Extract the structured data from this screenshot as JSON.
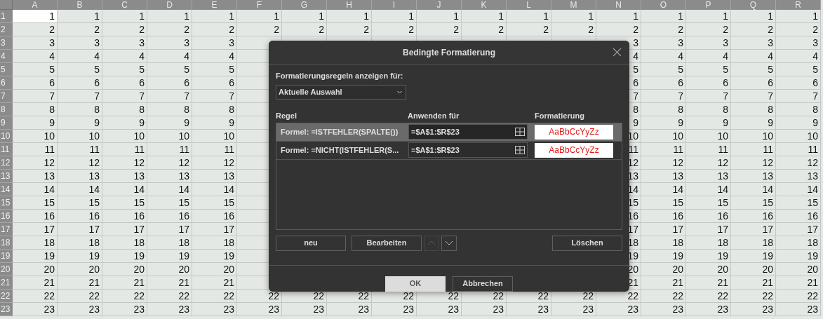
{
  "sheet": {
    "columns": [
      "A",
      "B",
      "C",
      "D",
      "E",
      "F",
      "G",
      "H",
      "I",
      "J",
      "K",
      "L",
      "M",
      "N",
      "O",
      "P",
      "Q",
      "R"
    ],
    "rows": [
      {
        "header": "1",
        "cells": [
          {
            "text": "1",
            "selected": true
          },
          {
            "text": "1",
            "selected": false
          },
          {
            "text": "1",
            "selected": false
          },
          {
            "text": "1",
            "selected": false
          },
          {
            "text": "1",
            "selected": false
          },
          {
            "text": "1",
            "selected": false
          },
          {
            "text": "1",
            "selected": false
          },
          {
            "text": "1",
            "selected": false
          },
          {
            "text": "1",
            "selected": false
          },
          {
            "text": "1",
            "selected": false
          },
          {
            "text": "1",
            "selected": false
          },
          {
            "text": "1",
            "selected": false
          },
          {
            "text": "1",
            "selected": false
          },
          {
            "text": "1",
            "selected": false
          },
          {
            "text": "1",
            "selected": false
          },
          {
            "text": "1",
            "selected": false
          },
          {
            "text": "1",
            "selected": false
          },
          {
            "text": "1",
            "selected": false
          }
        ]
      },
      {
        "header": "2",
        "cells": [
          {
            "text": "2",
            "selected": false
          },
          {
            "text": "2",
            "selected": false
          },
          {
            "text": "2",
            "selected": false
          },
          {
            "text": "2",
            "selected": false
          },
          {
            "text": "2",
            "selected": false
          },
          {
            "text": "2",
            "selected": false
          },
          {
            "text": "2",
            "selected": false
          },
          {
            "text": "2",
            "selected": false
          },
          {
            "text": "2",
            "selected": false
          },
          {
            "text": "2",
            "selected": false
          },
          {
            "text": "2",
            "selected": false
          },
          {
            "text": "2",
            "selected": false
          },
          {
            "text": "2",
            "selected": false
          },
          {
            "text": "2",
            "selected": false
          },
          {
            "text": "2",
            "selected": false
          },
          {
            "text": "2",
            "selected": false
          },
          {
            "text": "2",
            "selected": false
          },
          {
            "text": "2",
            "selected": false
          }
        ]
      },
      {
        "header": "3",
        "cells_left": [
          {
            "text": "3",
            "selected": false
          },
          {
            "text": "3",
            "selected": false
          },
          {
            "text": "3",
            "selected": false
          },
          {
            "text": "3",
            "selected": false
          },
          {
            "text": "3",
            "selected": false
          }
        ],
        "cells_right": [
          {
            "text": "3",
            "selected": false
          },
          {
            "text": "3",
            "selected": false
          },
          {
            "text": "3",
            "selected": false
          },
          {
            "text": "3",
            "selected": false
          },
          {
            "text": "3",
            "selected": false
          }
        ]
      },
      {
        "header": "4",
        "cells_left": [
          {
            "text": "4",
            "selected": false
          },
          {
            "text": "4",
            "selected": false
          },
          {
            "text": "4",
            "selected": false
          },
          {
            "text": "4",
            "selected": false
          },
          {
            "text": "4",
            "selected": false
          }
        ],
        "cells_right": [
          {
            "text": "4",
            "selected": false
          },
          {
            "text": "4",
            "selected": false
          },
          {
            "text": "4",
            "selected": false
          },
          {
            "text": "4",
            "selected": false
          },
          {
            "text": "4",
            "selected": false
          }
        ]
      },
      {
        "header": "5",
        "cells_left": [
          {
            "text": "5",
            "selected": false
          },
          {
            "text": "5",
            "selected": false
          },
          {
            "text": "5",
            "selected": false
          },
          {
            "text": "5",
            "selected": false
          },
          {
            "text": "5",
            "selected": false
          }
        ],
        "cells_right": [
          {
            "text": "5",
            "selected": false
          },
          {
            "text": "5",
            "selected": false
          },
          {
            "text": "5",
            "selected": false
          },
          {
            "text": "5",
            "selected": false
          },
          {
            "text": "5",
            "selected": false
          }
        ]
      },
      {
        "header": "6",
        "cells_left": [
          {
            "text": "6",
            "selected": false
          },
          {
            "text": "6",
            "selected": false
          },
          {
            "text": "6",
            "selected": false
          },
          {
            "text": "6",
            "selected": false
          },
          {
            "text": "6",
            "selected": false
          }
        ],
        "cells_right": [
          {
            "text": "6",
            "selected": false
          },
          {
            "text": "6",
            "selected": false
          },
          {
            "text": "6",
            "selected": false
          },
          {
            "text": "6",
            "selected": false
          },
          {
            "text": "6",
            "selected": false
          }
        ]
      },
      {
        "header": "7",
        "cells_left": [
          {
            "text": "7",
            "selected": false
          },
          {
            "text": "7",
            "selected": false
          },
          {
            "text": "7",
            "selected": false
          },
          {
            "text": "7",
            "selected": false
          },
          {
            "text": "7",
            "selected": false
          }
        ],
        "cells_right": [
          {
            "text": "7",
            "selected": false
          },
          {
            "text": "7",
            "selected": false
          },
          {
            "text": "7",
            "selected": false
          },
          {
            "text": "7",
            "selected": false
          },
          {
            "text": "7",
            "selected": false
          }
        ]
      },
      {
        "header": "8",
        "cells_left": [
          {
            "text": "8",
            "selected": false
          },
          {
            "text": "8",
            "selected": false
          },
          {
            "text": "8",
            "selected": false
          },
          {
            "text": "8",
            "selected": false
          },
          {
            "text": "8",
            "selected": false
          }
        ],
        "cells_right": [
          {
            "text": "8",
            "selected": false
          },
          {
            "text": "8",
            "selected": false
          },
          {
            "text": "8",
            "selected": false
          },
          {
            "text": "8",
            "selected": false
          },
          {
            "text": "8",
            "selected": false
          }
        ]
      },
      {
        "header": "9",
        "cells_left": [
          {
            "text": "9",
            "selected": false
          },
          {
            "text": "9",
            "selected": false
          },
          {
            "text": "9",
            "selected": false
          },
          {
            "text": "9",
            "selected": false
          },
          {
            "text": "9",
            "selected": false
          }
        ],
        "cells_right": [
          {
            "text": "9",
            "selected": false
          },
          {
            "text": "9",
            "selected": false
          },
          {
            "text": "9",
            "selected": false
          },
          {
            "text": "9",
            "selected": false
          },
          {
            "text": "9",
            "selected": false
          }
        ]
      },
      {
        "header": "10",
        "cells_left": [
          {
            "text": "10",
            "selected": false
          },
          {
            "text": "10",
            "selected": false
          },
          {
            "text": "10",
            "selected": false
          },
          {
            "text": "10",
            "selected": false
          },
          {
            "text": "10",
            "selected": false
          }
        ],
        "cells_right": [
          {
            "text": "10",
            "selected": false
          },
          {
            "text": "10",
            "selected": false
          },
          {
            "text": "10",
            "selected": false
          },
          {
            "text": "10",
            "selected": false
          },
          {
            "text": "10",
            "selected": false
          }
        ]
      },
      {
        "header": "11",
        "cells_left": [
          {
            "text": "11",
            "selected": false
          },
          {
            "text": "11",
            "selected": false
          },
          {
            "text": "11",
            "selected": false
          },
          {
            "text": "11",
            "selected": false
          },
          {
            "text": "11",
            "selected": false
          }
        ],
        "cells_right": [
          {
            "text": "11",
            "selected": false
          },
          {
            "text": "11",
            "selected": false
          },
          {
            "text": "11",
            "selected": false
          },
          {
            "text": "11",
            "selected": false
          },
          {
            "text": "11",
            "selected": false
          }
        ]
      },
      {
        "header": "12",
        "cells_left": [
          {
            "text": "12",
            "selected": false
          },
          {
            "text": "12",
            "selected": false
          },
          {
            "text": "12",
            "selected": false
          },
          {
            "text": "12",
            "selected": false
          },
          {
            "text": "12",
            "selected": false
          }
        ],
        "cells_right": [
          {
            "text": "12",
            "selected": false
          },
          {
            "text": "12",
            "selected": false
          },
          {
            "text": "12",
            "selected": false
          },
          {
            "text": "12",
            "selected": false
          },
          {
            "text": "12",
            "selected": false
          }
        ]
      },
      {
        "header": "13",
        "cells_left": [
          {
            "text": "13",
            "selected": false
          },
          {
            "text": "13",
            "selected": false
          },
          {
            "text": "13",
            "selected": false
          },
          {
            "text": "13",
            "selected": false
          },
          {
            "text": "13",
            "selected": false
          }
        ],
        "cells_right": [
          {
            "text": "13",
            "selected": false
          },
          {
            "text": "13",
            "selected": false
          },
          {
            "text": "13",
            "selected": false
          },
          {
            "text": "13",
            "selected": false
          },
          {
            "text": "13",
            "selected": false
          }
        ]
      },
      {
        "header": "14",
        "cells_left": [
          {
            "text": "14",
            "selected": false
          },
          {
            "text": "14",
            "selected": false
          },
          {
            "text": "14",
            "selected": false
          },
          {
            "text": "14",
            "selected": false
          },
          {
            "text": "14",
            "selected": false
          }
        ],
        "cells_right": [
          {
            "text": "14",
            "selected": false
          },
          {
            "text": "14",
            "selected": false
          },
          {
            "text": "14",
            "selected": false
          },
          {
            "text": "14",
            "selected": false
          },
          {
            "text": "14",
            "selected": false
          }
        ]
      },
      {
        "header": "15",
        "cells_left": [
          {
            "text": "15",
            "selected": false
          },
          {
            "text": "15",
            "selected": false
          },
          {
            "text": "15",
            "selected": false
          },
          {
            "text": "15",
            "selected": false
          },
          {
            "text": "15",
            "selected": false
          }
        ],
        "cells_right": [
          {
            "text": "15",
            "selected": false
          },
          {
            "text": "15",
            "selected": false
          },
          {
            "text": "15",
            "selected": false
          },
          {
            "text": "15",
            "selected": false
          },
          {
            "text": "15",
            "selected": false
          }
        ]
      },
      {
        "header": "16",
        "cells_left": [
          {
            "text": "16",
            "selected": false
          },
          {
            "text": "16",
            "selected": false
          },
          {
            "text": "16",
            "selected": false
          },
          {
            "text": "16",
            "selected": false
          },
          {
            "text": "16",
            "selected": false
          }
        ],
        "cells_right": [
          {
            "text": "16",
            "selected": false
          },
          {
            "text": "16",
            "selected": false
          },
          {
            "text": "16",
            "selected": false
          },
          {
            "text": "16",
            "selected": false
          },
          {
            "text": "16",
            "selected": false
          }
        ]
      },
      {
        "header": "17",
        "cells_left": [
          {
            "text": "17",
            "selected": false
          },
          {
            "text": "17",
            "selected": false
          },
          {
            "text": "17",
            "selected": false
          },
          {
            "text": "17",
            "selected": false
          },
          {
            "text": "17",
            "selected": false
          }
        ],
        "cells_right": [
          {
            "text": "17",
            "selected": false
          },
          {
            "text": "17",
            "selected": false
          },
          {
            "text": "17",
            "selected": false
          },
          {
            "text": "17",
            "selected": false
          },
          {
            "text": "17",
            "selected": false
          }
        ]
      },
      {
        "header": "18",
        "cells_left": [
          {
            "text": "18",
            "selected": false
          },
          {
            "text": "18",
            "selected": false
          },
          {
            "text": "18",
            "selected": false
          },
          {
            "text": "18",
            "selected": false
          },
          {
            "text": "18",
            "selected": false
          }
        ],
        "cells_right": [
          {
            "text": "18",
            "selected": false
          },
          {
            "text": "18",
            "selected": false
          },
          {
            "text": "18",
            "selected": false
          },
          {
            "text": "18",
            "selected": false
          },
          {
            "text": "18",
            "selected": false
          }
        ]
      },
      {
        "header": "19",
        "cells_left": [
          {
            "text": "19",
            "selected": false
          },
          {
            "text": "19",
            "selected": false
          },
          {
            "text": "19",
            "selected": false
          },
          {
            "text": "19",
            "selected": false
          },
          {
            "text": "19",
            "selected": false
          }
        ],
        "cells_right": [
          {
            "text": "19",
            "selected": false
          },
          {
            "text": "19",
            "selected": false
          },
          {
            "text": "19",
            "selected": false
          },
          {
            "text": "19",
            "selected": false
          },
          {
            "text": "19",
            "selected": false
          }
        ]
      },
      {
        "header": "20",
        "cells_left": [
          {
            "text": "20",
            "selected": false
          },
          {
            "text": "20",
            "selected": false
          },
          {
            "text": "20",
            "selected": false
          },
          {
            "text": "20",
            "selected": false
          },
          {
            "text": "20",
            "selected": false
          }
        ],
        "cells_right": [
          {
            "text": "20",
            "selected": false
          },
          {
            "text": "20",
            "selected": false
          },
          {
            "text": "20",
            "selected": false
          },
          {
            "text": "20",
            "selected": false
          },
          {
            "text": "20",
            "selected": false
          }
        ]
      },
      {
        "header": "21",
        "cells_left": [
          {
            "text": "21",
            "selected": false
          },
          {
            "text": "21",
            "selected": false
          },
          {
            "text": "21",
            "selected": false
          },
          {
            "text": "21",
            "selected": false
          },
          {
            "text": "21",
            "selected": false
          }
        ],
        "cells_right": [
          {
            "text": "21",
            "selected": false
          },
          {
            "text": "21",
            "selected": false
          },
          {
            "text": "21",
            "selected": false
          },
          {
            "text": "21",
            "selected": false
          },
          {
            "text": "21",
            "selected": false
          }
        ]
      },
      {
        "header": "22",
        "cells": [
          {
            "text": "22",
            "selected": false
          },
          {
            "text": "22",
            "selected": false
          },
          {
            "text": "22",
            "selected": false
          },
          {
            "text": "22",
            "selected": false
          },
          {
            "text": "22",
            "selected": false
          },
          {
            "text": "22",
            "selected": false
          },
          {
            "text": "22",
            "selected": false
          },
          {
            "text": "22",
            "selected": false
          },
          {
            "text": "22",
            "selected": false
          },
          {
            "text": "22",
            "selected": false
          },
          {
            "text": "22",
            "selected": false
          },
          {
            "text": "22",
            "selected": false
          },
          {
            "text": "22",
            "selected": false
          },
          {
            "text": "22",
            "selected": false
          },
          {
            "text": "22",
            "selected": false
          },
          {
            "text": "22",
            "selected": false
          },
          {
            "text": "22",
            "selected": false
          },
          {
            "text": "22",
            "selected": false
          }
        ]
      },
      {
        "header": "23",
        "cells": [
          {
            "text": "23",
            "selected": false
          },
          {
            "text": "23",
            "selected": false
          },
          {
            "text": "23",
            "selected": false
          },
          {
            "text": "23",
            "selected": false
          },
          {
            "text": "23",
            "selected": false
          },
          {
            "text": "23",
            "selected": false
          },
          {
            "text": "23",
            "selected": false
          },
          {
            "text": "23",
            "selected": false
          },
          {
            "text": "23",
            "selected": false
          },
          {
            "text": "23",
            "selected": false
          },
          {
            "text": "23",
            "selected": false
          },
          {
            "text": "23",
            "selected": false
          },
          {
            "text": "23",
            "selected": false
          },
          {
            "text": "23",
            "selected": false
          },
          {
            "text": "23",
            "selected": false
          },
          {
            "text": "23",
            "selected": false
          },
          {
            "text": "23",
            "selected": false
          },
          {
            "text": "23",
            "selected": false
          }
        ]
      }
    ]
  },
  "dialog": {
    "title": "Bedingte Formatierung",
    "filter_label": "Formatierungsregeln anzeigen für:",
    "filter_value": "Aktuelle Auswahl",
    "columns": [
      "Regel",
      "Anwenden für",
      "Formatierung"
    ],
    "rules": [
      {
        "rule": "Formel: =ISTFEHLER(SPALTE())",
        "applies_to": "=$A$1:$R$23",
        "preview": "AaBbCcYyZz",
        "selected": true
      },
      {
        "rule": "Formel: =NICHT(ISTFEHLER(S...",
        "applies_to": "=$A$1:$R$23",
        "preview": "AaBbCcYyZz",
        "selected": false
      }
    ],
    "actions": [
      {
        "kind": "text",
        "label": "neu"
      },
      {
        "kind": "text",
        "label": "Bearbeiten"
      },
      {
        "kind": "up",
        "disabled": true
      },
      {
        "kind": "down",
        "disabled": false
      },
      {
        "kind": "spacer"
      },
      {
        "kind": "text",
        "label": "Löschen"
      }
    ],
    "footer": [
      {
        "label": "OK",
        "primary": true
      },
      {
        "label": "Abbrechen",
        "primary": false
      }
    ]
  }
}
